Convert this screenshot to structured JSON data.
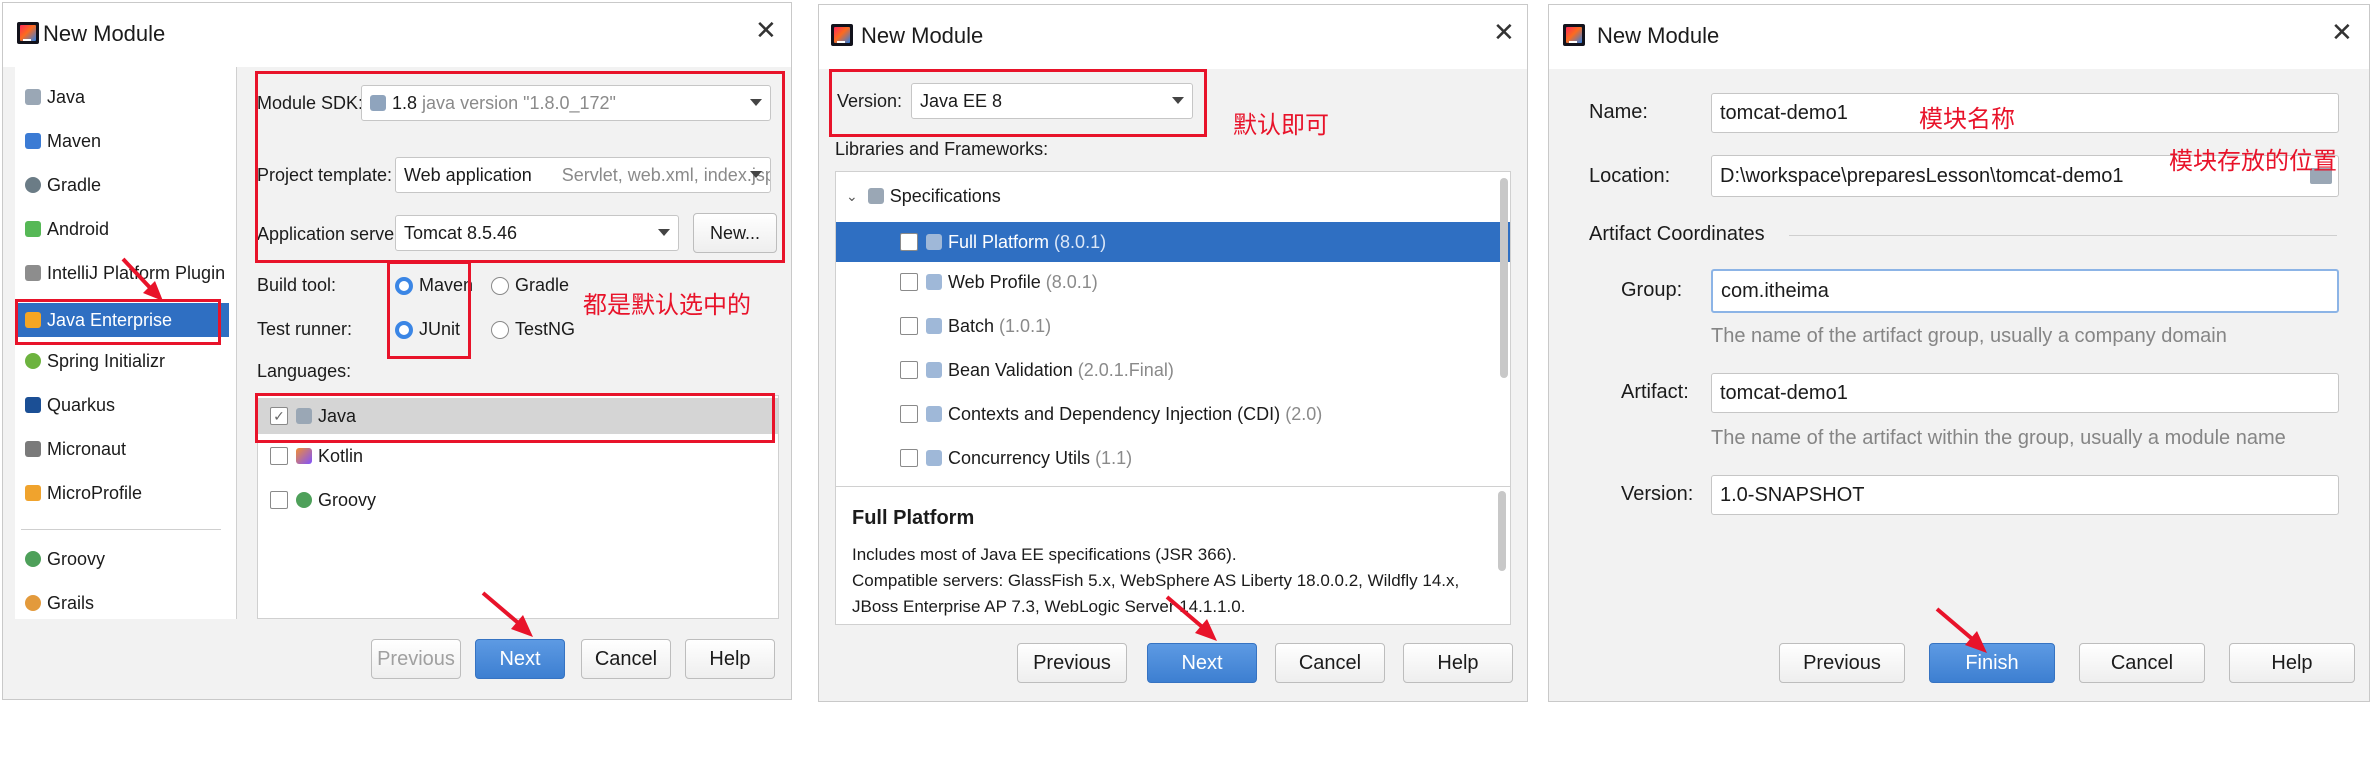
{
  "dialog_title": "New Module",
  "d1": {
    "sidebar": {
      "items": [
        {
          "label": "Java"
        },
        {
          "label": "Maven"
        },
        {
          "label": "Gradle"
        },
        {
          "label": "Android"
        },
        {
          "label": "IntelliJ Platform Plugin"
        },
        {
          "label": "Java Enterprise"
        },
        {
          "label": "Spring Initializr"
        },
        {
          "label": "Quarkus"
        },
        {
          "label": "Micronaut"
        },
        {
          "label": "MicroProfile"
        },
        {
          "label": "Groovy"
        },
        {
          "label": "Grails"
        }
      ],
      "selected": "Java Enterprise"
    },
    "module_sdk_label": "Module SDK:",
    "module_sdk_version": "1.8",
    "module_sdk_detail": "java version \"1.8.0_172\"",
    "project_template_label": "Project template:",
    "project_template_value": "Web application",
    "project_template_hint": "Servlet, web.xml, index.jsp",
    "app_server_label": "Application server:",
    "app_server_value": "Tomcat 8.5.46",
    "new_button": "New...",
    "build_tool_label": "Build tool:",
    "build_tool_options": [
      "Maven",
      "Gradle"
    ],
    "test_runner_label": "Test runner:",
    "test_runner_options": [
      "JUnit",
      "TestNG"
    ],
    "languages_label": "Languages:",
    "languages": [
      "Java",
      "Kotlin",
      "Groovy"
    ],
    "annotation": "都是默认选中的",
    "buttons": {
      "previous": "Previous",
      "next": "Next",
      "cancel": "Cancel",
      "help": "Help"
    }
  },
  "d2": {
    "version_label": "Version:",
    "version_value": "Java EE 8",
    "annotation": "默认即可",
    "libraries_label": "Libraries and Frameworks:",
    "tree_root": "Specifications",
    "specs": [
      {
        "name": "Full Platform",
        "version": "(8.0.1)"
      },
      {
        "name": "Web Profile",
        "version": "(8.0.1)"
      },
      {
        "name": "Batch",
        "version": "(1.0.1)"
      },
      {
        "name": "Bean Validation",
        "version": "(2.0.1.Final)"
      },
      {
        "name": "Contexts and Dependency Injection (CDI)",
        "version": "(2.0)"
      },
      {
        "name": "Concurrency Utils",
        "version": "(1.1)"
      }
    ],
    "desc_title": "Full Platform",
    "desc_lines": [
      "Includes most of Java EE specifications (JSR 366).",
      "Compatible servers: GlassFish 5.x, WebSphere AS Liberty 18.0.0.2, Wildfly 14.x,",
      "JBoss Enterprise AP 7.3, WebLogic Server 14.1.1.0."
    ],
    "buttons": {
      "previous": "Previous",
      "next": "Next",
      "cancel": "Cancel",
      "help": "Help"
    }
  },
  "d3": {
    "name_label": "Name:",
    "name_value": "tomcat-demo1",
    "name_annotation": "模块名称",
    "location_label": "Location:",
    "location_value": "D:\\workspace\\preparesLesson\\tomcat-demo1",
    "location_annotation": "模块存放的位置",
    "artifact_coords_label": "Artifact Coordinates",
    "group_label": "Group:",
    "group_value": "com.itheima",
    "group_hint": "The name of the artifact group, usually a company domain",
    "artifact_label": "Artifact:",
    "artifact_value": "tomcat-demo1",
    "artifact_hint": "The name of the artifact within the group, usually a module name",
    "version_label": "Version:",
    "version_value": "1.0-SNAPSHOT",
    "buttons": {
      "previous": "Previous",
      "finish": "Finish",
      "cancel": "Cancel",
      "help": "Help"
    }
  },
  "colors": {
    "accent": "#3d7fd1",
    "selection": "#2f6fc2",
    "annotation": "#e8132a"
  }
}
